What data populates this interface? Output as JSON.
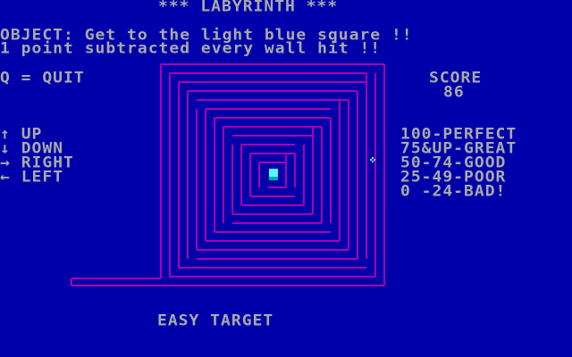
{
  "title": "*** LABYRINTH ***",
  "objective": {
    "line1": "OBJECT: Get to the light blue square !!",
    "line2": "1 point subtracted every wall hit !!"
  },
  "controls": {
    "quit": "Q = QUIT",
    "up": "UP",
    "down": "DOWN",
    "right": "RIGHT",
    "left": "LEFT"
  },
  "score": {
    "label": "SCORE",
    "value": "86"
  },
  "ratings": [
    "100-PERFECT",
    "75&UP-GREAT",
    "50-74-GOOD",
    "25-49-POOR",
    "0 -24-BAD!"
  ],
  "status": "EASY TARGET",
  "colors": {
    "background": "#0000aa",
    "text": "#aaaaaa",
    "maze_wall": "#aa00aa",
    "target": "#55ffff",
    "player": "#55ffff"
  },
  "icons": {
    "up": "arrow-up-icon",
    "down": "arrow-down-icon",
    "right": "arrow-right-icon",
    "left": "arrow-left-icon"
  }
}
